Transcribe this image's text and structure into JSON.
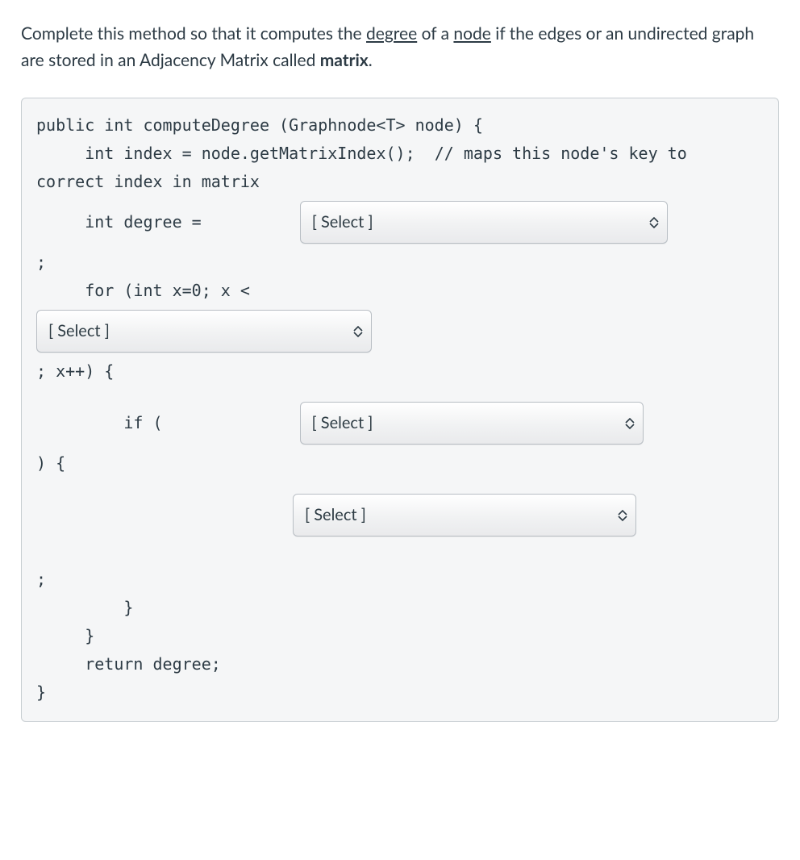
{
  "question": {
    "pre1": "Complete this method so that it computes the ",
    "u1": "degree",
    "mid1": " of a ",
    "u2": "node",
    "mid2": " if the edges or an undirected graph are stored in an Adjacency Matrix called ",
    "bold1": "matrix",
    "end": "."
  },
  "code": {
    "l1": "public int computeDegree (Graphnode<T> node) {",
    "l2": "     int index = node.getMatrixIndex();  // maps this node's key to correct index in matrix",
    "l3": "",
    "l4_pre": "     int degree = ",
    "l5": ";",
    "l6": "     for (int x=0; x < ",
    "l7": "; x++) {",
    "l8_pre": "         if (",
    "l9": ") {",
    "l10": ";",
    "l11": "         }",
    "l12": "     }",
    "l13": "     return degree;",
    "l14": "}"
  },
  "selects": {
    "placeholder": "[ Select ]"
  }
}
